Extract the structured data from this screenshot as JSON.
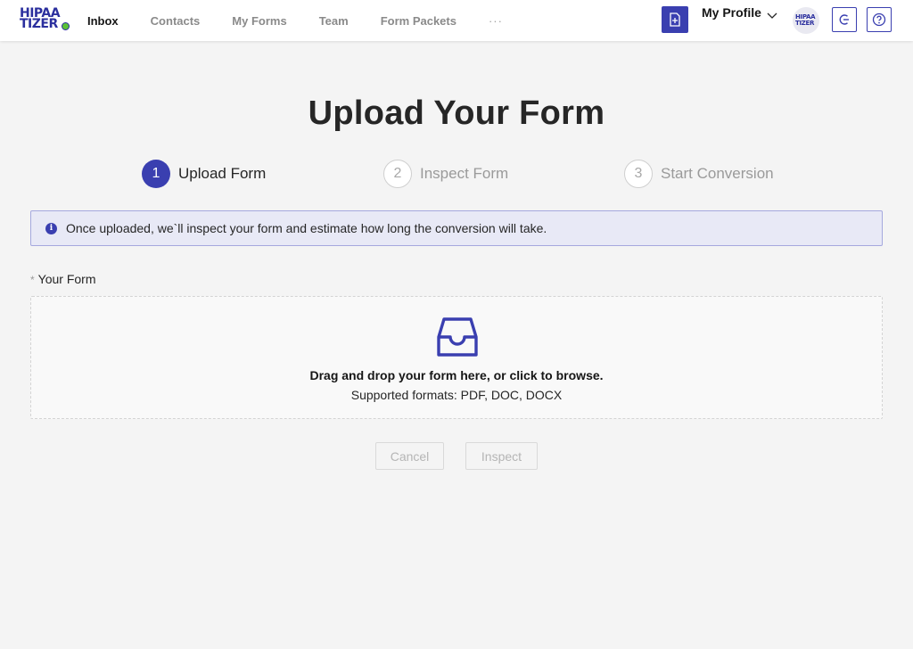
{
  "brand": {
    "logo_line1": "HIPAA",
    "logo_line2": "TIZER"
  },
  "nav": {
    "items": [
      {
        "label": "Inbox",
        "active": true
      },
      {
        "label": "Contacts",
        "active": false
      },
      {
        "label": "My Forms",
        "active": false
      },
      {
        "label": "Team",
        "active": false
      },
      {
        "label": "Form Packets",
        "active": false
      }
    ],
    "more": "···"
  },
  "header": {
    "new_form_icon": "file-plus-icon",
    "profile_label": "My Profile",
    "avatar_line1": "HIPAA",
    "avatar_line2": "TIZER",
    "logout_icon": "logout-icon",
    "help_icon": "help-icon"
  },
  "page": {
    "title": "Upload Your Form"
  },
  "steps": [
    {
      "number": "1",
      "label": "Upload Form",
      "state": "current"
    },
    {
      "number": "2",
      "label": "Inspect Form",
      "state": "pending"
    },
    {
      "number": "3",
      "label": "Start Conversion",
      "state": "pending"
    }
  ],
  "info": {
    "icon": "i",
    "text": "Once uploaded, we`ll inspect your form and estimate how long the conversion will take."
  },
  "form": {
    "required_marker": "*",
    "field_label": "Your Form",
    "dropzone_icon": "inbox-tray-icon",
    "dropzone_title": "Drag and drop your form here, or click to browse.",
    "dropzone_subtitle": "Supported formats: PDF, DOC, DOCX"
  },
  "actions": {
    "cancel_label": "Cancel",
    "inspect_label": "Inspect"
  },
  "colors": {
    "accent": "#3a3fb0",
    "background": "#f4f4f4",
    "banner_bg": "#e8e9f6",
    "banner_border": "#a5a8de"
  }
}
